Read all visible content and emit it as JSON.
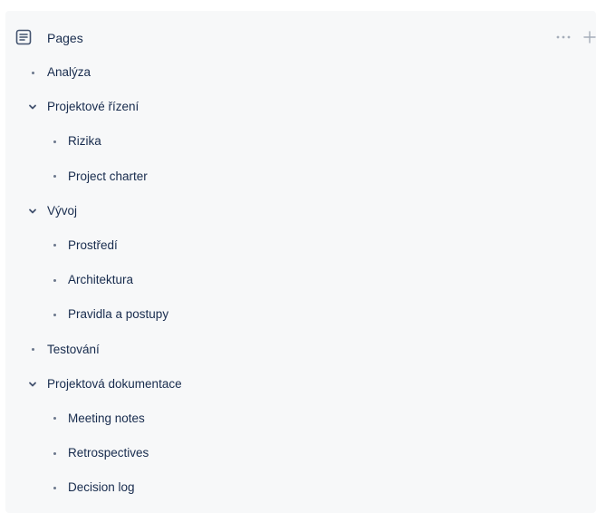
{
  "header": {
    "title": "Pages",
    "icons": {
      "pages": "document-icon",
      "more": "more-horizontal-icon",
      "add": "plus-icon"
    }
  },
  "tree": [
    {
      "label": "Analýza",
      "level": 0,
      "marker": "bullet"
    },
    {
      "label": "Projektové řízení",
      "level": 0,
      "marker": "chevron-down"
    },
    {
      "label": "Rizika",
      "level": 1,
      "marker": "bullet"
    },
    {
      "label": "Project charter",
      "level": 1,
      "marker": "bullet"
    },
    {
      "label": "Vývoj",
      "level": 0,
      "marker": "chevron-down"
    },
    {
      "label": "Prostředí",
      "level": 1,
      "marker": "bullet"
    },
    {
      "label": "Architektura",
      "level": 1,
      "marker": "bullet"
    },
    {
      "label": "Pravidla a postupy",
      "level": 1,
      "marker": "bullet"
    },
    {
      "label": "Testování",
      "level": 0,
      "marker": "bullet"
    },
    {
      "label": "Projektová dokumentace",
      "level": 0,
      "marker": "chevron-down"
    },
    {
      "label": "Meeting notes",
      "level": 1,
      "marker": "bullet"
    },
    {
      "label": "Retrospectives",
      "level": 1,
      "marker": "bullet"
    },
    {
      "label": "Decision log",
      "level": 1,
      "marker": "bullet"
    }
  ],
  "colors": {
    "panel_background": "#f7f8f9",
    "text": "#172b4d",
    "icon": "#42526e",
    "muted_icon": "#a5adba"
  }
}
